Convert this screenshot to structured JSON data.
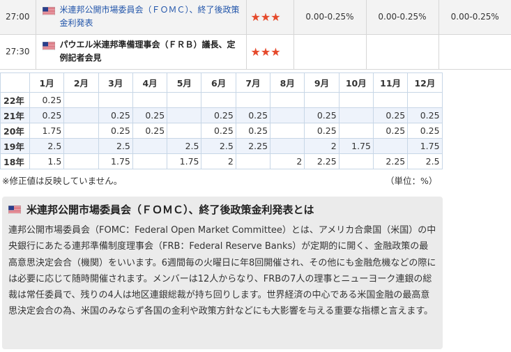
{
  "events": [
    {
      "time": "27:00",
      "title": "米連邦公開市場委員会（ＦＯＭＣ）、終了後政策金利発表",
      "linked": true,
      "stars": "★★★",
      "prev": "0.00-0.25%",
      "forecast": "0.00-0.25%",
      "result": "0.00-0.25%"
    },
    {
      "time": "27:30",
      "title": "パウエル米連邦準備理事会（ＦＲＢ）議長、定例記者会見",
      "linked": false,
      "stars": "★★★",
      "prev": "",
      "forecast": "",
      "result": ""
    }
  ],
  "history": {
    "months": [
      "1月",
      "2月",
      "3月",
      "4月",
      "5月",
      "6月",
      "7月",
      "8月",
      "9月",
      "10月",
      "11月",
      "12月"
    ],
    "rows": [
      {
        "year": "22年",
        "values": [
          "0.25",
          "",
          "",
          "",
          "",
          "",
          "",
          "",
          "",
          "",
          "",
          ""
        ]
      },
      {
        "year": "21年",
        "values": [
          "0.25",
          "",
          "0.25",
          "0.25",
          "",
          "0.25",
          "0.25",
          "",
          "0.25",
          "",
          "0.25",
          "0.25"
        ]
      },
      {
        "year": "20年",
        "values": [
          "1.75",
          "",
          "0.25",
          "0.25",
          "",
          "0.25",
          "0.25",
          "",
          "0.25",
          "",
          "0.25",
          "0.25"
        ]
      },
      {
        "year": "19年",
        "values": [
          "2.5",
          "",
          "2.5",
          "",
          "2.5",
          "2.5",
          "2.25",
          "",
          "2",
          "1.75",
          "",
          "1.75"
        ]
      },
      {
        "year": "18年",
        "values": [
          "1.5",
          "",
          "1.75",
          "",
          "1.75",
          "2",
          "",
          "2",
          "2.25",
          "",
          "2.25",
          "2.5"
        ]
      }
    ],
    "note": "※修正値は反映していません。",
    "unit": "（単位：%）"
  },
  "description": {
    "title": "米連邦公開市場委員会（ＦＯＭＣ）、終了後政策金利発表とは",
    "body": "連邦公開市場委員会（FOMC：Federal Open Market Committee）とは、アメリカ合衆国（米国）の中央銀行にあたる連邦準備制度理事会（FRB：Federal Reserve Banks）が定期的に開く、金融政策の最高意思決定会合（機関）をいいます。6週間毎の火曜日に年8回開催され、その他にも金融危機などの際には必要に応じて随時開催されます。メンバーは12人からなり、FRBの7人の理事とニューヨーク連銀の総裁は常任委員で、残りの4人は地区連銀総裁が持ち回りします。世界経済の中心である米国金融の最高意思決定会合の為、米国のみならず各国の金利や政策方針などにも大影響を与える重要な指標と言えます。"
  },
  "colors": {
    "link": "#2255aa",
    "stars": "#e54a2c",
    "grid_border": "#c7d6e6",
    "row_highlight": "#eef3fb",
    "panel_bg": "#ebebeb"
  },
  "icons": {
    "flag": "us-flag-icon"
  }
}
